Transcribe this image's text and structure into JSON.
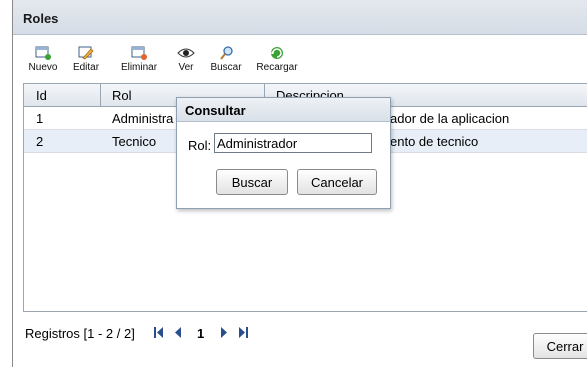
{
  "window": {
    "title": "Roles"
  },
  "toolbar": {
    "items": [
      {
        "label": "Nuevo",
        "icon": "new-document-icon"
      },
      {
        "label": "Editar",
        "icon": "edit-pencil-icon"
      },
      {
        "label": "Eliminar",
        "icon": "delete-document-icon"
      },
      {
        "label": "Ver",
        "icon": "eye-icon"
      },
      {
        "label": "Buscar",
        "icon": "magnifier-icon"
      },
      {
        "label": "Recargar",
        "icon": "refresh-icon"
      }
    ]
  },
  "table": {
    "columns": [
      "Id",
      "Rol",
      "Descripcion"
    ],
    "rows": [
      {
        "id": "1",
        "rol": "Administra",
        "descripcion": "ador de la aplicacion"
      },
      {
        "id": "2",
        "rol": "Tecnico",
        "descripcion": "ento de tecnico"
      }
    ]
  },
  "pager": {
    "text": "Registros [1 - 2 / 2]",
    "current_page": "1",
    "icons": [
      "first-page-icon",
      "prev-page-icon",
      "next-page-icon",
      "last-page-icon"
    ]
  },
  "footer": {
    "close_label": "Cerrar"
  },
  "dialog": {
    "title": "Consultar",
    "field_label": "Rol:",
    "field_value": "Administrador",
    "search_label": "Buscar",
    "cancel_label": "Cancelar"
  },
  "colors": {
    "accent_blue": "#2a4f8f",
    "row_alt": "#e7eef7",
    "title_bg": "#d6dde6"
  }
}
